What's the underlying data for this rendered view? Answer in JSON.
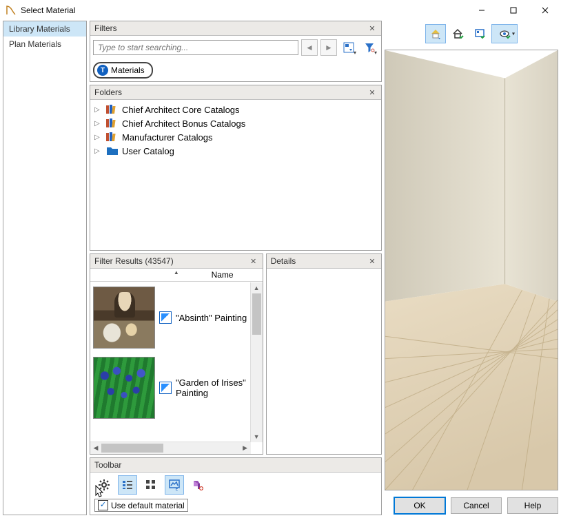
{
  "window": {
    "title": "Select Material"
  },
  "left_tabs": {
    "library": "Library Materials",
    "plan": "Plan Materials"
  },
  "filters": {
    "header": "Filters",
    "search_placeholder": "Type to start searching...",
    "chip_label": "Materials"
  },
  "folders": {
    "header": "Folders",
    "items": [
      {
        "label": "Chief Architect Core Catalogs",
        "icon": "books"
      },
      {
        "label": "Chief Architect Bonus Catalogs",
        "icon": "books"
      },
      {
        "label": "Manufacturer Catalogs",
        "icon": "books"
      },
      {
        "label": "User Catalog",
        "icon": "folder"
      }
    ]
  },
  "results": {
    "header": "Filter Results (43547)",
    "column": "Name",
    "items": [
      {
        "label": "\"Absinth\" Painting"
      },
      {
        "label": "\"Garden of Irises\" Painting"
      }
    ]
  },
  "details": {
    "header": "Details"
  },
  "toolbar": {
    "header": "Toolbar",
    "use_default_label": "Use default material"
  },
  "buttons": {
    "ok": "OK",
    "cancel": "Cancel",
    "help": "Help"
  }
}
